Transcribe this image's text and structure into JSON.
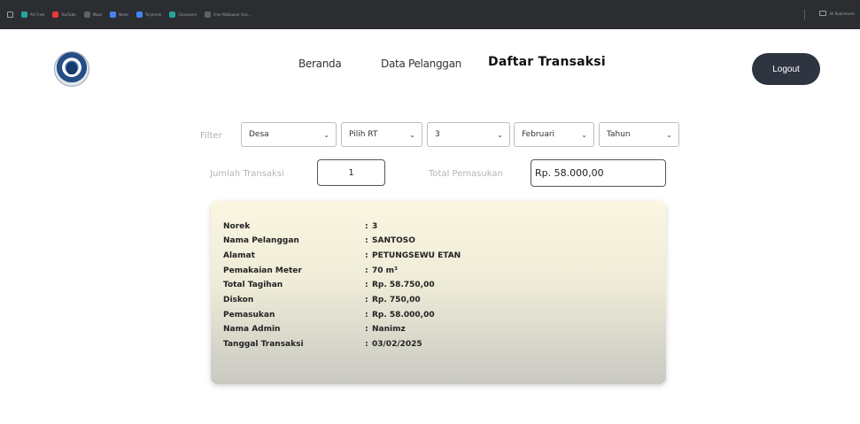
{
  "bookmarks": [
    {
      "label": "All Crew",
      "icon": "grid-icon"
    },
    {
      "label": "YouTube",
      "icon": "youtube-icon"
    },
    {
      "label": "Maps",
      "icon": "maps-icon"
    },
    {
      "label": "News",
      "icon": "news-icon"
    },
    {
      "label": "Terjemah",
      "icon": "translate-icon"
    },
    {
      "label": "Classroom",
      "icon": "classroom-icon"
    },
    {
      "label": "Free Wallpaper Gos...",
      "icon": "wallpaper-icon"
    }
  ],
  "bookmarks_right": "All Bookmarks",
  "nav": {
    "home": "Beranda",
    "customers": "Data Pelanggan",
    "transactions": "Daftar Transaksi"
  },
  "logout_label": "Logout",
  "filter": {
    "label": "Filter",
    "desa": "Desa",
    "rt": "Pilih RT",
    "number": "3",
    "month": "Februari",
    "year": "Tahun"
  },
  "summary": {
    "count_label": "Jumlah Transaksi",
    "count_value": "1",
    "total_label": "Total Pemasukan",
    "total_value": "Rp. 58.000,00"
  },
  "transaction": {
    "rows": [
      {
        "key": "Norek",
        "value": "3"
      },
      {
        "key": "Nama Pelanggan",
        "value": "SANTOSO"
      },
      {
        "key": "Alamat",
        "value": "PETUNGSEWU ETAN"
      },
      {
        "key": "Pemakaian Meter",
        "value": "70 m³"
      },
      {
        "key": "Total Tagihan",
        "value": "Rp. 58.750,00"
      },
      {
        "key": "Diskon",
        "value": "Rp. 750,00"
      },
      {
        "key": "Pemasukan",
        "value": "Rp. 58.000,00"
      },
      {
        "key": "Nama Admin",
        "value": "Nanimz"
      },
      {
        "key": "Tanggal Transaksi",
        "value": "03/02/2025"
      }
    ],
    "separator": ":"
  }
}
